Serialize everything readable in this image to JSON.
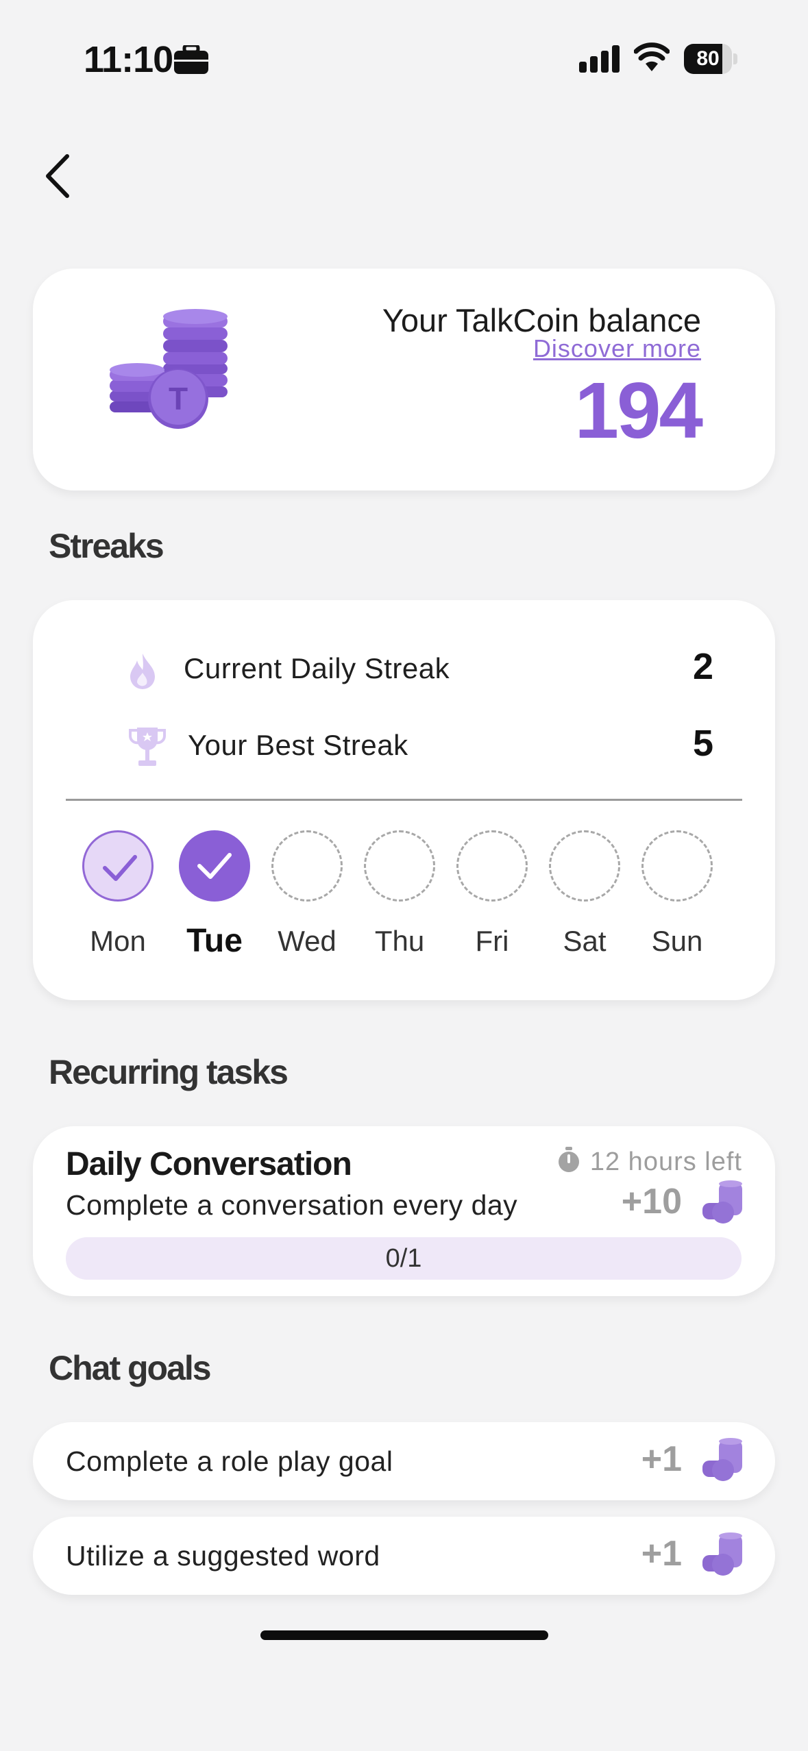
{
  "status_bar": {
    "time": "11:10",
    "battery": "80",
    "battery_level": 0.8
  },
  "balance": {
    "label": "Your TalkCoin balance",
    "discover": "Discover more",
    "value": "194"
  },
  "streaks": {
    "title": "Streaks",
    "current_label": "Current Daily Streak",
    "current_value": "2",
    "best_label": "Your Best Streak",
    "best_value": "5",
    "days": [
      {
        "label": "Mon",
        "state": "done-light"
      },
      {
        "label": "Tue",
        "state": "done-full"
      },
      {
        "label": "Wed",
        "state": "pending"
      },
      {
        "label": "Thu",
        "state": "pending"
      },
      {
        "label": "Fri",
        "state": "pending"
      },
      {
        "label": "Sat",
        "state": "pending"
      },
      {
        "label": "Sun",
        "state": "pending"
      }
    ]
  },
  "recurring": {
    "title": "Recurring tasks",
    "task": {
      "title": "Daily Conversation",
      "description": "Complete a conversation every day",
      "time_left": "12 hours left",
      "reward": "+10",
      "progress_text": "0/1",
      "progress": 0
    }
  },
  "chat_goals": {
    "title": "Chat goals",
    "items": [
      {
        "label": "Complete a role play goal",
        "reward": "+1"
      },
      {
        "label": "Utilize a suggested word",
        "reward": "+1"
      }
    ]
  },
  "colors": {
    "accent": "#8a5fd6",
    "accent_light": "#e6d8f7",
    "background": "#f3f3f4"
  }
}
